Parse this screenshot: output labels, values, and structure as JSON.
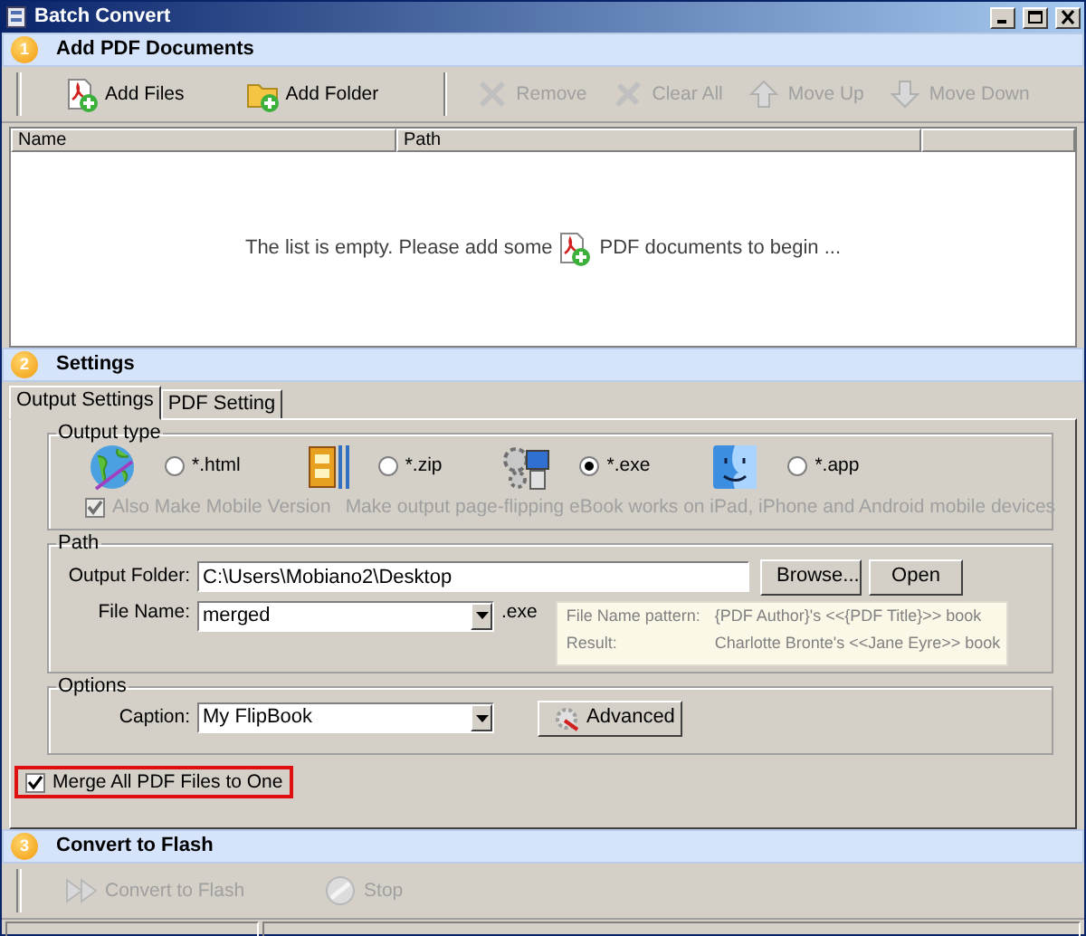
{
  "window": {
    "title": "Batch Convert"
  },
  "add_section": {
    "number": "1",
    "title": "Add PDF Documents",
    "toolbar": [
      {
        "kind": "add-files",
        "label": "Add Files",
        "disabled": false
      },
      {
        "kind": "add-folder",
        "label": "Add Folder",
        "disabled": false
      },
      {
        "kind": "remove",
        "label": "Remove",
        "disabled": true
      },
      {
        "kind": "clear",
        "label": "Clear All",
        "disabled": true
      },
      {
        "kind": "up",
        "label": "Move Up",
        "disabled": true
      },
      {
        "kind": "down",
        "label": "Move Down",
        "disabled": true
      }
    ],
    "file_list": {
      "columns": [
        "Name",
        "Path"
      ],
      "empty_before": "The list is empty. Please add some",
      "empty_after": "PDF documents to begin ..."
    }
  },
  "settings_section": {
    "number": "2",
    "title": "Settings",
    "tabs": [
      {
        "label": "Output Settings",
        "selected": true
      },
      {
        "label": "PDF Setting",
        "selected": false
      }
    ],
    "output_type": {
      "legend": "Output type",
      "options": [
        {
          "kind": "globe",
          "label": "*.html",
          "selected": false
        },
        {
          "kind": "zip",
          "label": "*.zip",
          "selected": false
        },
        {
          "kind": "exe",
          "label": "*.exe",
          "selected": true
        },
        {
          "kind": "mac",
          "label": "*.app",
          "selected": false
        }
      ],
      "mobile": {
        "label": "Also Make Mobile Version",
        "checked": true,
        "disabled": true
      },
      "mobile_note": "Make output page-flipping eBook works on iPad, iPhone and Android mobile devices"
    },
    "path": {
      "legend": "Path",
      "output_folder": {
        "label": "Output Folder:",
        "value": "C:\\Users\\Mobiano2\\Desktop"
      },
      "buttons": [
        "Browse...",
        "Open"
      ],
      "file_name": {
        "label": "File Name:",
        "value": "merged",
        "extension": ".exe"
      },
      "pattern": [
        {
          "label": "File Name pattern:",
          "value": "{PDF Author}'s <<{PDF Title}>> book"
        },
        {
          "label": "Result:",
          "value": "Charlotte Bronte's <<Jane Eyre>> book"
        }
      ]
    },
    "options": {
      "legend": "Options",
      "caption": {
        "label": "Caption:",
        "value": "My FlipBook"
      },
      "advanced_button": "Advanced"
    },
    "merge": {
      "label": "Merge All PDF Files to One",
      "checked": true,
      "highlighted": true
    }
  },
  "convert_section": {
    "number": "3",
    "title": "Convert to Flash",
    "toolbar": [
      {
        "kind": "convert",
        "label": "Convert to Flash",
        "disabled": true
      },
      {
        "kind": "stop",
        "label": "Stop",
        "disabled": true
      }
    ]
  }
}
